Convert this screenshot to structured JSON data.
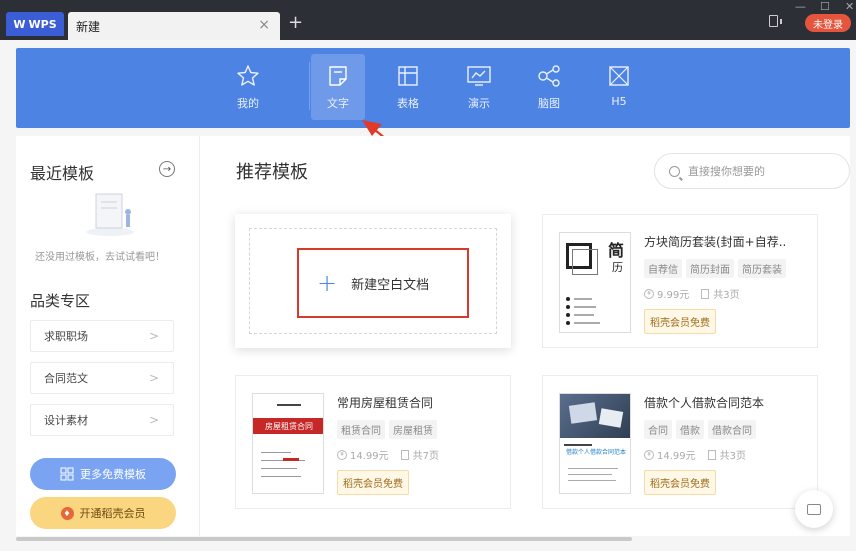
{
  "titlebar": {
    "app_tab": "WPS",
    "doc_tab": "新建",
    "close_glyph": "×",
    "add_glyph": "+",
    "login": "未登录"
  },
  "toolbar": {
    "items": [
      {
        "label": "我的",
        "icon": "star-icon"
      },
      {
        "label": "文字",
        "icon": "document-icon",
        "active": true
      },
      {
        "label": "表格",
        "icon": "table-icon"
      },
      {
        "label": "演示",
        "icon": "presentation-icon"
      },
      {
        "label": "脑图",
        "icon": "mindmap-icon"
      },
      {
        "label": "H5",
        "icon": "h5-icon"
      }
    ]
  },
  "sidebar": {
    "recent_title": "最近模板",
    "empty_text": "还没用过模板，去试试看吧！",
    "category_title": "品类专区",
    "categories": [
      "求职职场",
      "合同范文",
      "设计素材"
    ],
    "more_button": "更多免费模板",
    "vip_button": "开通稻壳会员"
  },
  "main": {
    "title": "推荐模板",
    "search_placeholder": "直接搜你想要的",
    "blank_doc": "新建空白文档",
    "templates": [
      {
        "name": "方块简历套装(封面+自荐..",
        "tags": [
          "自荐信",
          "简历封面",
          "简历套装"
        ],
        "price": "9.99元",
        "pages": "共3页",
        "vip": "稻壳会员免费",
        "thumb_title": "简",
        "thumb_sub": "历"
      },
      {
        "name": "常用房屋租赁合同",
        "tags": [
          "租赁合同",
          "房屋租赁"
        ],
        "price": "14.99元",
        "pages": "共7页",
        "vip": "稻壳会员免费",
        "thumb_title": "房屋租赁合同"
      },
      {
        "name": "借款个人借款合同范本",
        "tags": [
          "合同",
          "借款",
          "借款合同"
        ],
        "price": "14.99元",
        "pages": "共3页",
        "vip": "稻壳会员免费",
        "thumb_title": "借款个人借款合同范本"
      }
    ]
  },
  "colors": {
    "toolbar_blue": "#4d83e3",
    "highlight_red": "#d9392b",
    "login_red": "#e5553d",
    "vip_yellow": "#fbd680"
  }
}
